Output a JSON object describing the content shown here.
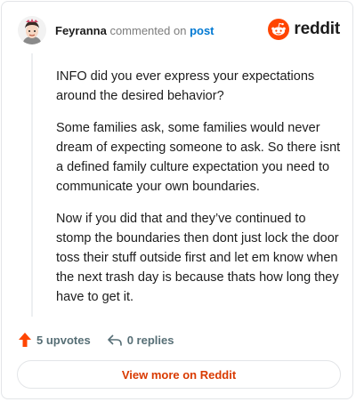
{
  "header": {
    "username": "Feyranna",
    "action_text": "commented on",
    "post_link": "post",
    "brand_name": "reddit",
    "brand_color": "#ff4500"
  },
  "comment": {
    "paragraphs": [
      "INFO did you ever express your expectations around the desired behavior?",
      "Some families ask, some families would never dream of expecting someone to ask. So there isnt a defined family culture expectation you need to communicate your own boundaries.",
      "Now if you did that and they’ve continued to stomp the boundaries then dont just lock the door toss their stuff outside first and let em know when the next trash day is because thats how long they have to get it."
    ]
  },
  "footer": {
    "upvotes_label": "5 upvotes",
    "replies_label": "0 replies",
    "upvote_icon": "upvote-arrow-icon",
    "reply_icon": "reply-arrow-icon",
    "upvote_color": "#ff4500"
  },
  "view_more_label": "View more on Reddit"
}
